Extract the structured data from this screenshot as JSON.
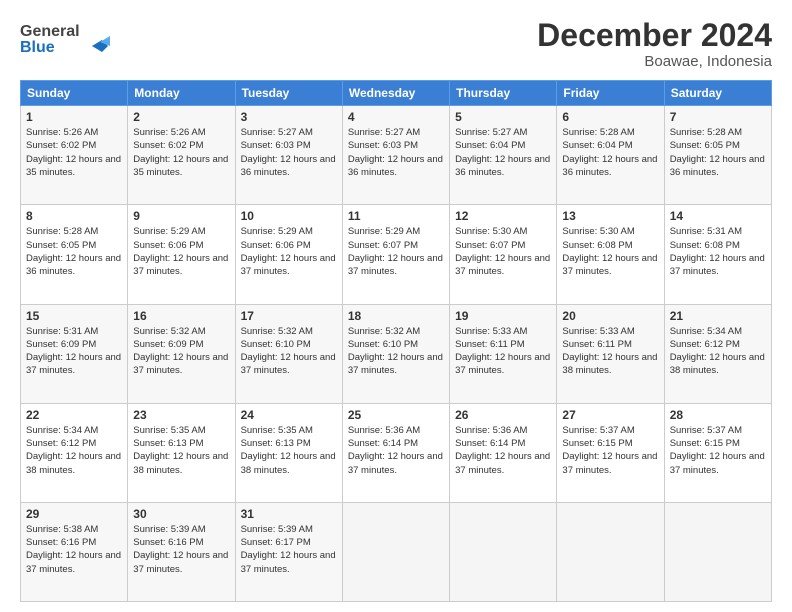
{
  "header": {
    "logo_line1": "General",
    "logo_line2": "Blue",
    "month": "December 2024",
    "location": "Boawae, Indonesia"
  },
  "weekdays": [
    "Sunday",
    "Monday",
    "Tuesday",
    "Wednesday",
    "Thursday",
    "Friday",
    "Saturday"
  ],
  "weeks": [
    [
      {
        "day": "1",
        "sunrise": "Sunrise: 5:26 AM",
        "sunset": "Sunset: 6:02 PM",
        "daylight": "Daylight: 12 hours and 35 minutes."
      },
      {
        "day": "2",
        "sunrise": "Sunrise: 5:26 AM",
        "sunset": "Sunset: 6:02 PM",
        "daylight": "Daylight: 12 hours and 35 minutes."
      },
      {
        "day": "3",
        "sunrise": "Sunrise: 5:27 AM",
        "sunset": "Sunset: 6:03 PM",
        "daylight": "Daylight: 12 hours and 36 minutes."
      },
      {
        "day": "4",
        "sunrise": "Sunrise: 5:27 AM",
        "sunset": "Sunset: 6:03 PM",
        "daylight": "Daylight: 12 hours and 36 minutes."
      },
      {
        "day": "5",
        "sunrise": "Sunrise: 5:27 AM",
        "sunset": "Sunset: 6:04 PM",
        "daylight": "Daylight: 12 hours and 36 minutes."
      },
      {
        "day": "6",
        "sunrise": "Sunrise: 5:28 AM",
        "sunset": "Sunset: 6:04 PM",
        "daylight": "Daylight: 12 hours and 36 minutes."
      },
      {
        "day": "7",
        "sunrise": "Sunrise: 5:28 AM",
        "sunset": "Sunset: 6:05 PM",
        "daylight": "Daylight: 12 hours and 36 minutes."
      }
    ],
    [
      {
        "day": "8",
        "sunrise": "Sunrise: 5:28 AM",
        "sunset": "Sunset: 6:05 PM",
        "daylight": "Daylight: 12 hours and 36 minutes."
      },
      {
        "day": "9",
        "sunrise": "Sunrise: 5:29 AM",
        "sunset": "Sunset: 6:06 PM",
        "daylight": "Daylight: 12 hours and 37 minutes."
      },
      {
        "day": "10",
        "sunrise": "Sunrise: 5:29 AM",
        "sunset": "Sunset: 6:06 PM",
        "daylight": "Daylight: 12 hours and 37 minutes."
      },
      {
        "day": "11",
        "sunrise": "Sunrise: 5:29 AM",
        "sunset": "Sunset: 6:07 PM",
        "daylight": "Daylight: 12 hours and 37 minutes."
      },
      {
        "day": "12",
        "sunrise": "Sunrise: 5:30 AM",
        "sunset": "Sunset: 6:07 PM",
        "daylight": "Daylight: 12 hours and 37 minutes."
      },
      {
        "day": "13",
        "sunrise": "Sunrise: 5:30 AM",
        "sunset": "Sunset: 6:08 PM",
        "daylight": "Daylight: 12 hours and 37 minutes."
      },
      {
        "day": "14",
        "sunrise": "Sunrise: 5:31 AM",
        "sunset": "Sunset: 6:08 PM",
        "daylight": "Daylight: 12 hours and 37 minutes."
      }
    ],
    [
      {
        "day": "15",
        "sunrise": "Sunrise: 5:31 AM",
        "sunset": "Sunset: 6:09 PM",
        "daylight": "Daylight: 12 hours and 37 minutes."
      },
      {
        "day": "16",
        "sunrise": "Sunrise: 5:32 AM",
        "sunset": "Sunset: 6:09 PM",
        "daylight": "Daylight: 12 hours and 37 minutes."
      },
      {
        "day": "17",
        "sunrise": "Sunrise: 5:32 AM",
        "sunset": "Sunset: 6:10 PM",
        "daylight": "Daylight: 12 hours and 37 minutes."
      },
      {
        "day": "18",
        "sunrise": "Sunrise: 5:32 AM",
        "sunset": "Sunset: 6:10 PM",
        "daylight": "Daylight: 12 hours and 37 minutes."
      },
      {
        "day": "19",
        "sunrise": "Sunrise: 5:33 AM",
        "sunset": "Sunset: 6:11 PM",
        "daylight": "Daylight: 12 hours and 37 minutes."
      },
      {
        "day": "20",
        "sunrise": "Sunrise: 5:33 AM",
        "sunset": "Sunset: 6:11 PM",
        "daylight": "Daylight: 12 hours and 38 minutes."
      },
      {
        "day": "21",
        "sunrise": "Sunrise: 5:34 AM",
        "sunset": "Sunset: 6:12 PM",
        "daylight": "Daylight: 12 hours and 38 minutes."
      }
    ],
    [
      {
        "day": "22",
        "sunrise": "Sunrise: 5:34 AM",
        "sunset": "Sunset: 6:12 PM",
        "daylight": "Daylight: 12 hours and 38 minutes."
      },
      {
        "day": "23",
        "sunrise": "Sunrise: 5:35 AM",
        "sunset": "Sunset: 6:13 PM",
        "daylight": "Daylight: 12 hours and 38 minutes."
      },
      {
        "day": "24",
        "sunrise": "Sunrise: 5:35 AM",
        "sunset": "Sunset: 6:13 PM",
        "daylight": "Daylight: 12 hours and 38 minutes."
      },
      {
        "day": "25",
        "sunrise": "Sunrise: 5:36 AM",
        "sunset": "Sunset: 6:14 PM",
        "daylight": "Daylight: 12 hours and 37 minutes."
      },
      {
        "day": "26",
        "sunrise": "Sunrise: 5:36 AM",
        "sunset": "Sunset: 6:14 PM",
        "daylight": "Daylight: 12 hours and 37 minutes."
      },
      {
        "day": "27",
        "sunrise": "Sunrise: 5:37 AM",
        "sunset": "Sunset: 6:15 PM",
        "daylight": "Daylight: 12 hours and 37 minutes."
      },
      {
        "day": "28",
        "sunrise": "Sunrise: 5:37 AM",
        "sunset": "Sunset: 6:15 PM",
        "daylight": "Daylight: 12 hours and 37 minutes."
      }
    ],
    [
      {
        "day": "29",
        "sunrise": "Sunrise: 5:38 AM",
        "sunset": "Sunset: 6:16 PM",
        "daylight": "Daylight: 12 hours and 37 minutes."
      },
      {
        "day": "30",
        "sunrise": "Sunrise: 5:39 AM",
        "sunset": "Sunset: 6:16 PM",
        "daylight": "Daylight: 12 hours and 37 minutes."
      },
      {
        "day": "31",
        "sunrise": "Sunrise: 5:39 AM",
        "sunset": "Sunset: 6:17 PM",
        "daylight": "Daylight: 12 hours and 37 minutes."
      },
      null,
      null,
      null,
      null
    ]
  ]
}
